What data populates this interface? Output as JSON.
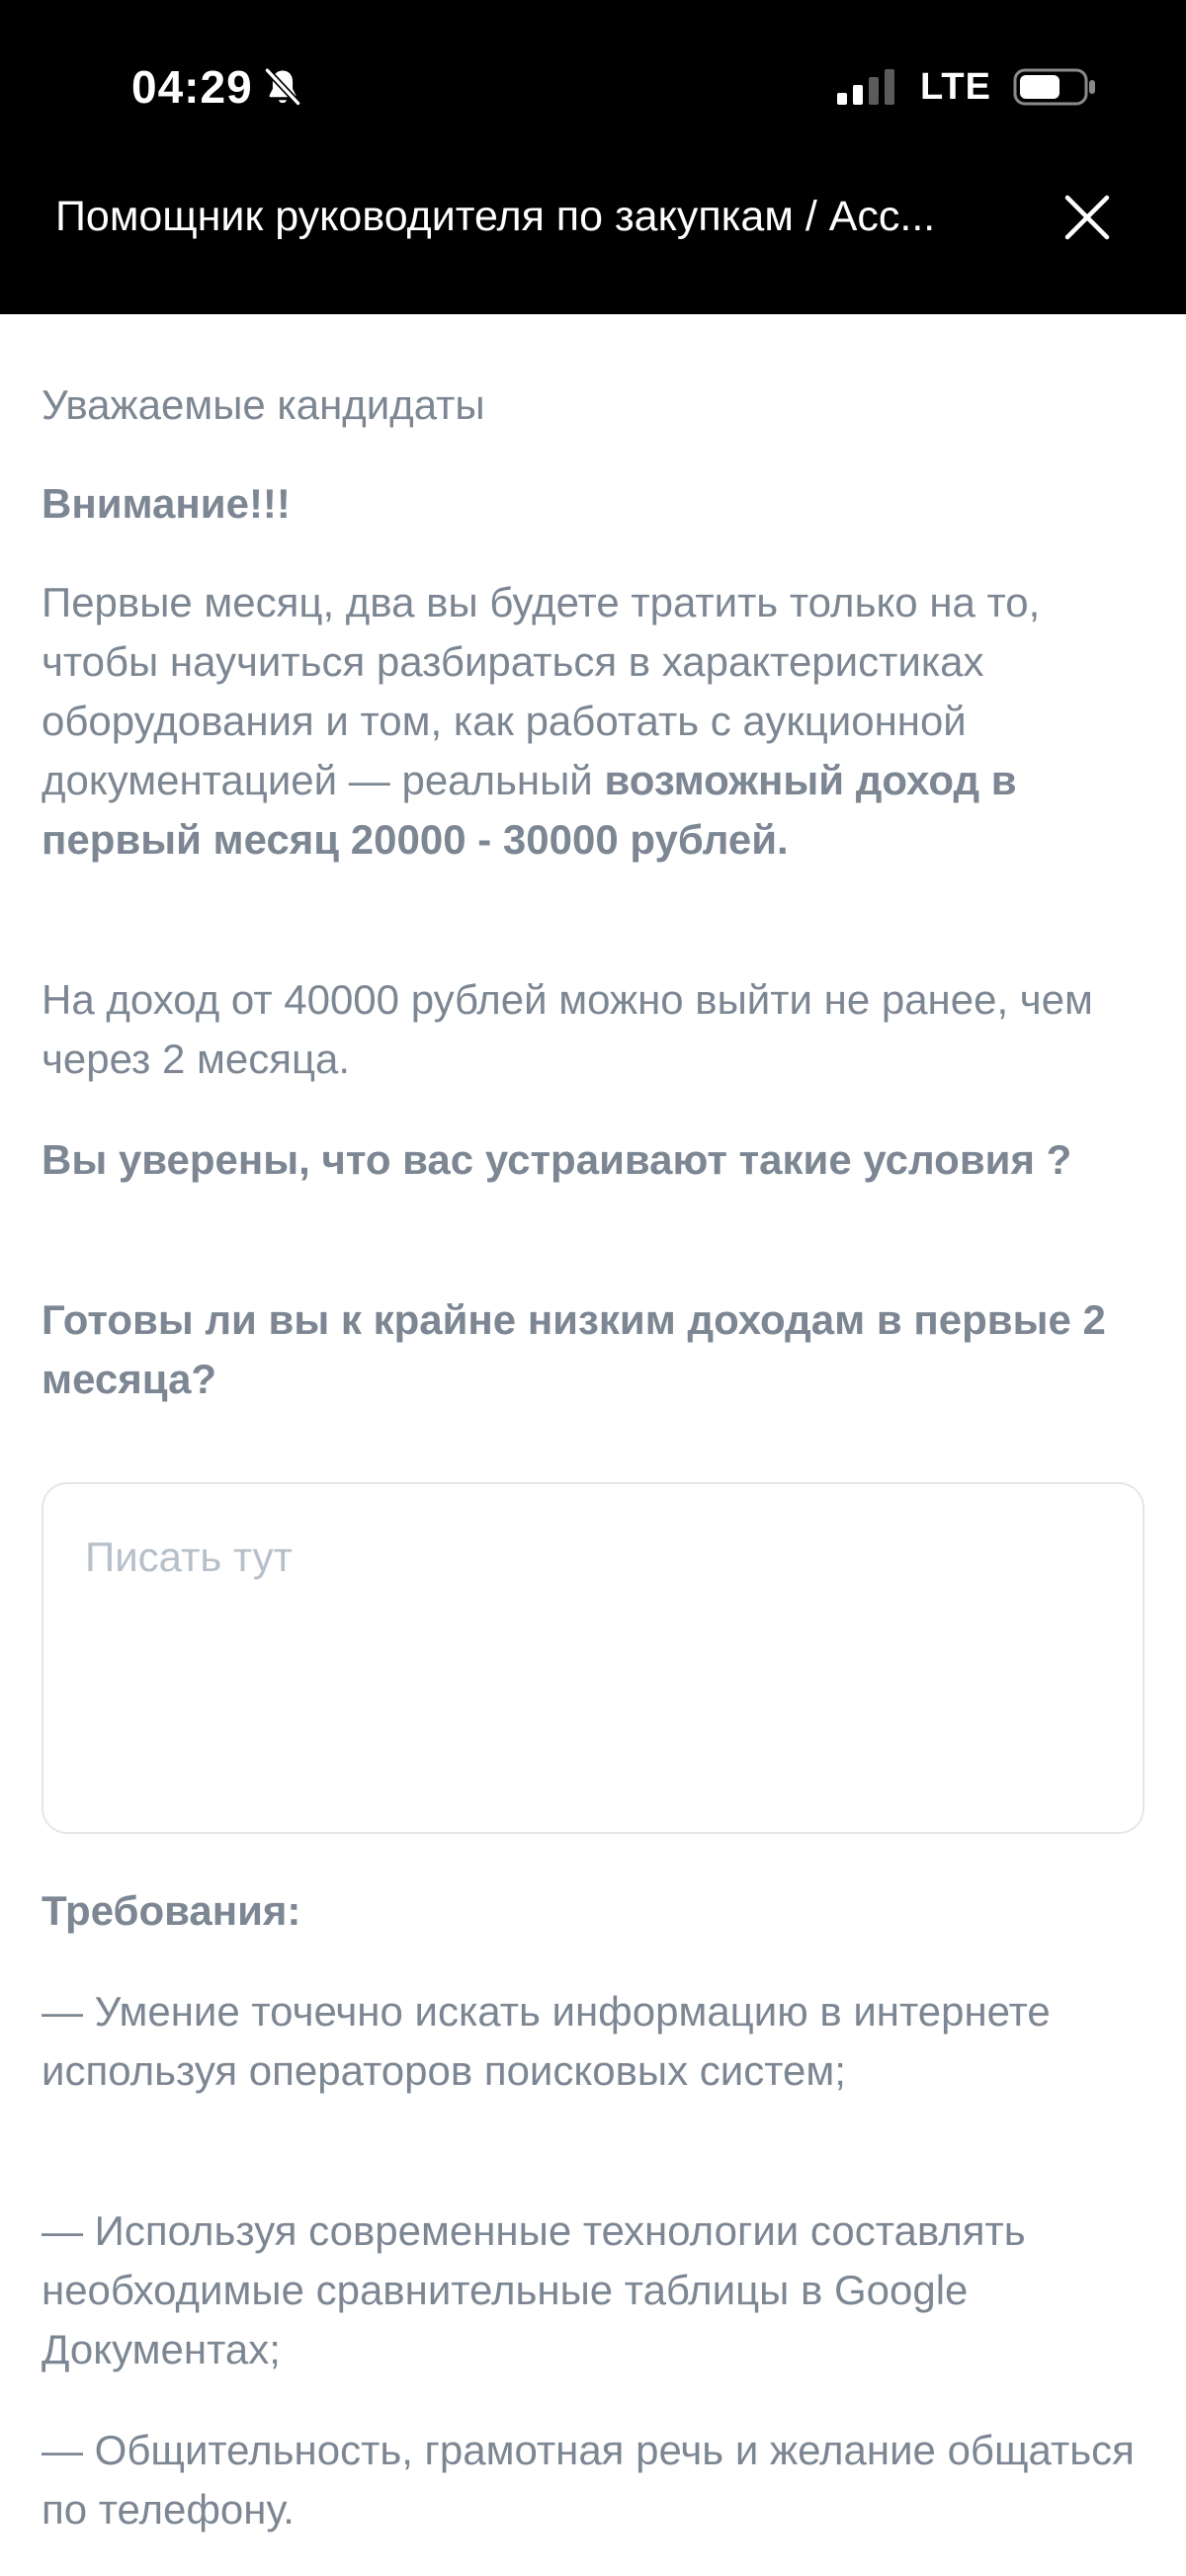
{
  "status_bar": {
    "time": "04:29",
    "network": "LTE"
  },
  "header": {
    "title": "Помощник руководителя по закупкам / Асс..."
  },
  "icons": {
    "bell": "bell-slash-icon",
    "signal": "cellular-signal-icon",
    "battery": "battery-icon",
    "close": "close-icon"
  },
  "content": {
    "greeting": "Уважаемые кандидаты",
    "attention": "Внимание!!!",
    "paragraph1_plain": "Первые месяц, два вы будете тратить только на то, чтобы научиться разбираться в характеристиках оборудования и том, как работать с аукционной документацией — реальный ",
    "paragraph1_bold": "возможный доход в первый месяц 20000 - 30000 рублей.",
    "paragraph2": "На доход от 40000 рублей можно выйти не ранее, чем через 2 месяца.",
    "question1": "Вы уверены, что вас устраивают такие условия ?",
    "question2": "Готовы ли вы к крайне низким доходам в первые 2 месяца?",
    "answer_input": {
      "placeholder": "Писать тут",
      "value": ""
    },
    "requirements_heading": "Требования:",
    "requirements": [
      "— Умение точечно искать информацию в интернете используя операторов поисковых систем;",
      "— Используя современные технологии составлять необходимые сравнительные таблицы в Google Документах;",
      "— Общительность, грамотная речь и желание общаться по телефону."
    ]
  },
  "colors": {
    "header_bg": "#000000",
    "text": "#7c8793",
    "placeholder": "#b6c0ca",
    "input_border": "#e3e7eb"
  }
}
